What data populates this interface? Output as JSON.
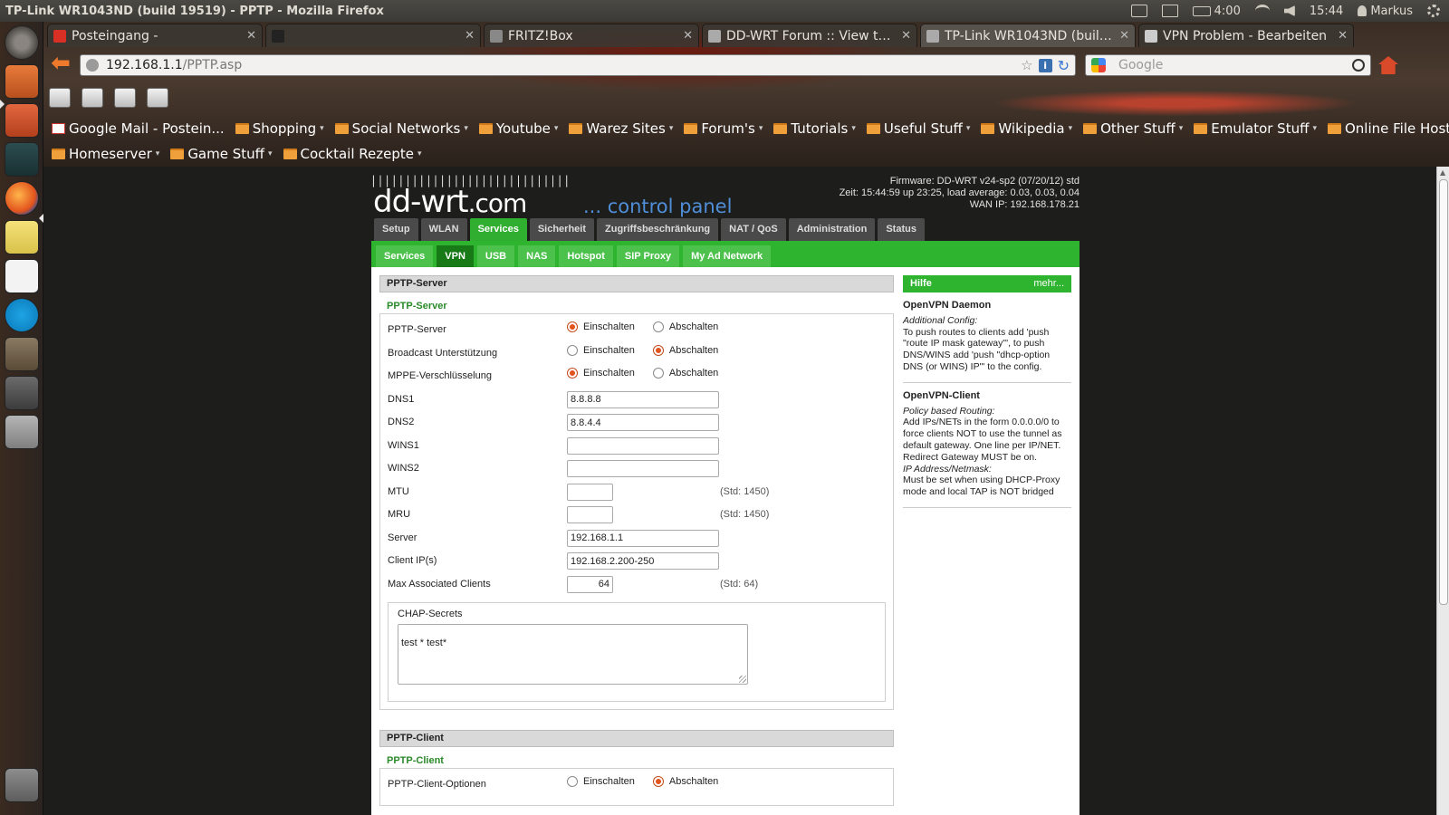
{
  "topbar": {
    "window_title": "TP-Link WR1043ND (build 19519) - PPTP - Mozilla Firefox",
    "battery": "4:00",
    "clock": "15:44",
    "user": "Markus"
  },
  "tabs": [
    {
      "label": "Posteingang - ",
      "icon": "gmail-icon",
      "color": "#d93025"
    },
    {
      "label": "",
      "icon": "tux-icon",
      "color": "#222222"
    },
    {
      "label": "FRITZ!Box",
      "icon": "page-icon",
      "color": "#888888"
    },
    {
      "label": "DD-WRT Forum :: View topi...",
      "icon": "ddwrt-icon",
      "color": "#aaaaaa"
    },
    {
      "label": "TP-Link WR1043ND (build 1...",
      "icon": "ddwrt-icon",
      "color": "#aaaaaa"
    },
    {
      "label": "VPN Problem - Bearbeiten",
      "icon": "stackexchange-icon",
      "color": "#cccccc"
    }
  ],
  "nav": {
    "url_host": "192.168.1.1",
    "url_path": "/PPTP.asp",
    "search_placeholder": "Google"
  },
  "bookmarks": {
    "row1": [
      "Google Mail - Postein...",
      "Shopping",
      "Social Networks",
      "Youtube",
      "Warez Sites",
      "Forum's",
      "Tutorials",
      "Useful Stuff",
      "Wikipedia",
      "Other Stuff",
      "Emulator Stuff",
      "Online File Hoster"
    ],
    "row2": [
      "Homeserver",
      "Game Stuff",
      "Cocktail Rezepte"
    ]
  },
  "router": {
    "logo": "dd-wrt",
    "logo_suffix": ".com",
    "logo_tagline": "... control panel",
    "firmware": "Firmware: DD-WRT v24-sp2 (07/20/12) std",
    "time": "Zeit: 15:44:59 up 23:25, load average: 0.03, 0.03, 0.04",
    "wan_ip": "WAN IP: 192.168.178.21",
    "main_tabs": [
      "Setup",
      "WLAN",
      "Services",
      "Sicherheit",
      "Zugriffsbeschränkung",
      "NAT / QoS",
      "Administration",
      "Status"
    ],
    "sub_tabs": [
      "Services",
      "VPN",
      "USB",
      "NAS",
      "Hotspot",
      "SIP Proxy",
      "My Ad Network"
    ],
    "radio_on": "Einschalten",
    "radio_off": "Abschalten",
    "server_section": {
      "header": "PPTP-Server",
      "legend": "PPTP-Server",
      "rows": {
        "pptp_server": "PPTP-Server",
        "broadcast": "Broadcast Unterstützung",
        "mppe": "MPPE-Verschlüsselung",
        "dns1": "DNS1",
        "dns2": "DNS2",
        "wins1": "WINS1",
        "wins2": "WINS2",
        "mtu": "MTU",
        "mru": "MRU",
        "server_ip": "Server",
        "client_ips": "Client IP(s)",
        "max_clients": "Max Associated Clients"
      },
      "values": {
        "dns1": "8.8.8.8",
        "dns2": "8.8.4.4",
        "wins1": "",
        "wins2": "",
        "mtu": "",
        "mru": "",
        "server_ip": "192.168.1.1",
        "client_ips": "192.168.2.200-250",
        "max_clients": "64"
      },
      "std_mtu": "(Std: 1450)",
      "std_mru": "(Std: 1450)",
      "std_clients": "(Std: 64)",
      "chap_label": "CHAP-Secrets",
      "chap_value": "test * test*"
    },
    "client_section": {
      "header": "PPTP-Client",
      "legend": "PPTP-Client",
      "options_label": "PPTP-Client-Optionen"
    },
    "help": {
      "title": "Hilfe",
      "more": "mehr...",
      "sections": [
        {
          "title": "OpenVPN Daemon",
          "subtitle": "Additional Config:",
          "text": "To push routes to clients add 'push \"route IP mask gateway\"', to push DNS/WINS add 'push \"dhcp-option DNS (or WINS) IP\"' to the config."
        },
        {
          "title": "OpenVPN-Client",
          "subtitle": "Policy based Routing:",
          "text": "Add IPs/NETs in the form 0.0.0.0/0 to force clients NOT to use the tunnel as default gateway. One line per IP/NET. Redirect Gateway MUST be on.",
          "subtitle2": "IP Address/Netmask:",
          "text2": "Must be set when using DHCP-Proxy mode and local TAP is NOT bridged"
        }
      ]
    }
  }
}
